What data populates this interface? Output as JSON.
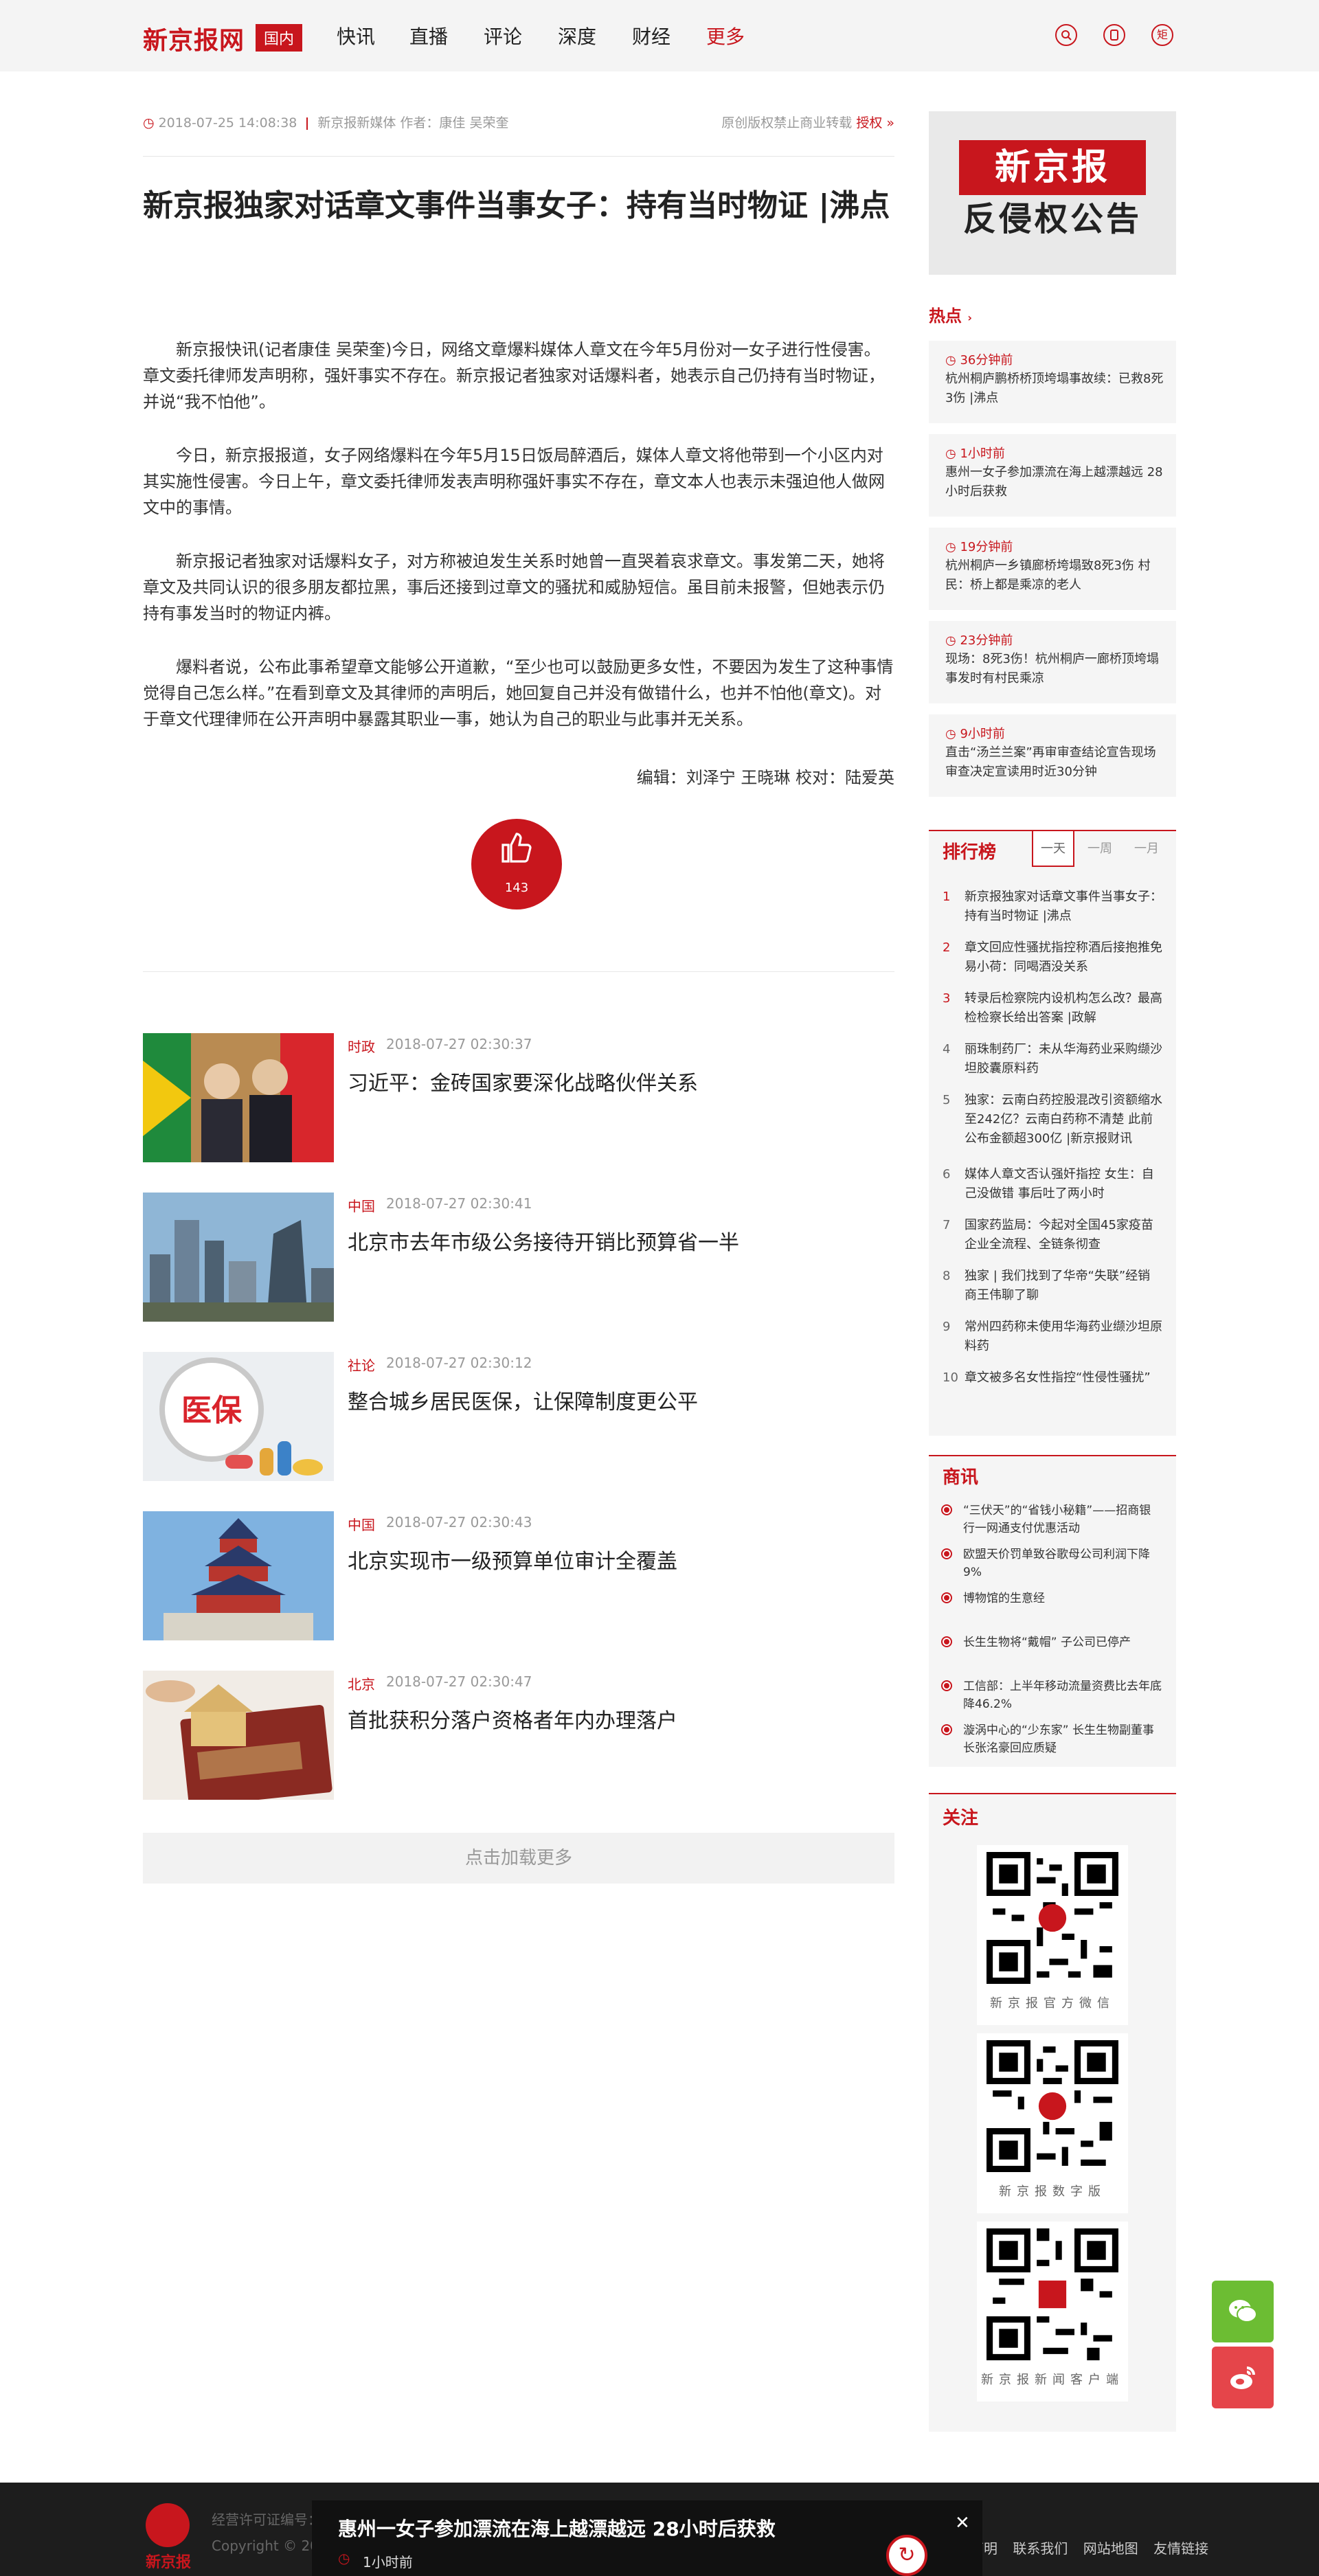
{
  "header": {
    "logo": "新京报网",
    "region": "国内",
    "nav": [
      "快讯",
      "直播",
      "评论",
      "深度",
      "财经",
      "更多"
    ],
    "icons": [
      "search-icon",
      "mobile-icon",
      "matrix-icon"
    ],
    "icon_matrix_label": "矩"
  },
  "article": {
    "time": "2018-07-25 14:08:38",
    "source": "新京报新媒体 作者：康佳 吴荣奎",
    "copyright": "原创版权禁止商业转载",
    "authorize": "授权",
    "title": "新京报独家对话章文事件当事女子：持有当时物证 |沸点",
    "paragraphs": [
      "新京报快讯(记者康佳 吴荣奎)今日，网络文章爆料媒体人章文在今年5月份对一女子进行性侵害。章文委托律师发声明称，强奸事实不存在。新京报记者独家对话爆料者，她表示自己仍持有当时物证，并说“我不怕他”。",
      "今日，新京报报道，女子网络爆料在今年5月15日饭局醉酒后，媒体人章文将他带到一个小区内对其实施性侵害。今日上午，章文委托律师发表声明称强奸事实不存在，章文本人也表示未强迫他人做网文中的事情。",
      "新京报记者独家对话爆料女子，对方称被迫发生关系时她曾一直哭着哀求章文。事发第二天，她将章文及共同认识的很多朋友都拉黑，事后还接到过章文的骚扰和威胁短信。虽目前未报警，但她表示仍持有事发当时的物证内裤。",
      "爆料者说，公布此事希望章文能够公开道歉，“至少也可以鼓励更多女性，不要因为发生了这种事情觉得自己怎么样。”在看到章文及其律师的声明后，她回复自己并没有做错什么，也并不怕他(章文)。对于章文代理律师在公开声明中暴露其职业一事，她认为自己的职业与此事并无关系。"
    ],
    "editor": "编辑：刘泽宁 王晓琳 校对：陆爱英",
    "likes": "143"
  },
  "news": [
    {
      "cat": "时政",
      "time": "2018-07-27 02:30:37",
      "title": "习近平：金砖国家要深化战略伙伴关系"
    },
    {
      "cat": "中国",
      "time": "2018-07-27 02:30:41",
      "title": "北京市去年市级公务接待开销比预算省一半"
    },
    {
      "cat": "社论",
      "time": "2018-07-27 02:30:12",
      "title": "整合城乡居民医保，让保障制度更公平",
      "img_text": "医保"
    },
    {
      "cat": "中国",
      "time": "2018-07-27 02:30:43",
      "title": "北京实现市一级预算单位审计全覆盖"
    },
    {
      "cat": "北京",
      "time": "2018-07-27 02:30:47",
      "title": "首批获积分落户资格者年内办理落户"
    }
  ],
  "load_more": "点击加载更多",
  "notice": {
    "line1": "新京报",
    "line2": "反侵权公告"
  },
  "hot": {
    "title": "热点",
    "items": [
      {
        "time": "36分钟前",
        "text": "杭州桐庐鹏桥桥顶垮塌事故续：已救8死3伤 |沸点"
      },
      {
        "time": "1小时前",
        "text": "惠州一女子参加漂流在海上越漂越远 28小时后获救"
      },
      {
        "time": "19分钟前",
        "text": "杭州桐庐一乡镇廊桥垮塌致8死3伤 村民：桥上都是乘凉的老人"
      },
      {
        "time": "23分钟前",
        "text": "现场：8死3伤！杭州桐庐一廊桥顶垮塌 事发时有村民乘凉"
      },
      {
        "time": "9小时前",
        "text": "直击“汤兰兰案”再审审查结论宣告现场 审查决定宣读用时近30分钟"
      }
    ]
  },
  "rank": {
    "title": "排行榜",
    "tabs": [
      "一天",
      "一周",
      "一月"
    ],
    "items": [
      "新京报独家对话章文事件当事女子：持有当时物证 |沸点",
      "章文回应性骚扰指控称酒后接抱推免 易小荷：同喝酒没关系",
      "转录后检察院内设机构怎么改？最高检检察长给出答案 |政解",
      "丽珠制药厂：未从华海药业采购缬沙坦胶囊原料药",
      "独家：云南白药控股混改引资额缩水至242亿？云南白药称不清楚 此前公布金额超300亿 |新京报财讯",
      "媒体人章文否认强奸指控 女生：自己没做错 事后吐了两小时",
      "国家药监局：今起对全国45家疫苗企业全流程、全链条彻查",
      "独家 | 我们找到了华帝“失联”经销商王伟聊了聊",
      "常州四药称未使用华海药业缬沙坦原料药",
      "章文被多名女性指控“性侵性骚扰”"
    ]
  },
  "biz": {
    "title": "商讯",
    "items": [
      "“三伏天”的“省钱小秘籍”——招商银行一网通支付优惠活动",
      "欧盟天价罚单致谷歌母公司利润下降9%",
      "博物馆的生意经",
      "长生生物将“戴帽” 子公司已停产",
      "工信部：上半年移动流量资费比去年底降46.2%",
      "漩涡中心的“少东家” 长生生物副董事长张洺豪回应质疑"
    ]
  },
  "follow": {
    "title": "关注",
    "qrs": [
      "新京报官方微信",
      "新京报数字版",
      "新京报新闻客户端"
    ]
  },
  "share": [
    "wechat-icon",
    "weibo-icon"
  ],
  "footer": {
    "logo_text": "新京报",
    "line1": "经营许可证编号：京ICP备11016501号-1 京公网安备11010102001756号 ...",
    "line2": "Copyright © 2003-2018",
    "links": [
      "版权声明",
      "联系我们",
      "网站地图",
      "友情链接"
    ]
  },
  "toast": {
    "title": "惠州一女子参加漂流在海上越漂越远 28小时后获救",
    "time": "1小时前"
  },
  "colors": {
    "brand": "#c8161d",
    "footer_bg": "#1d1d1d",
    "wechat": "#6cbd33",
    "weibo": "#e5454a"
  }
}
